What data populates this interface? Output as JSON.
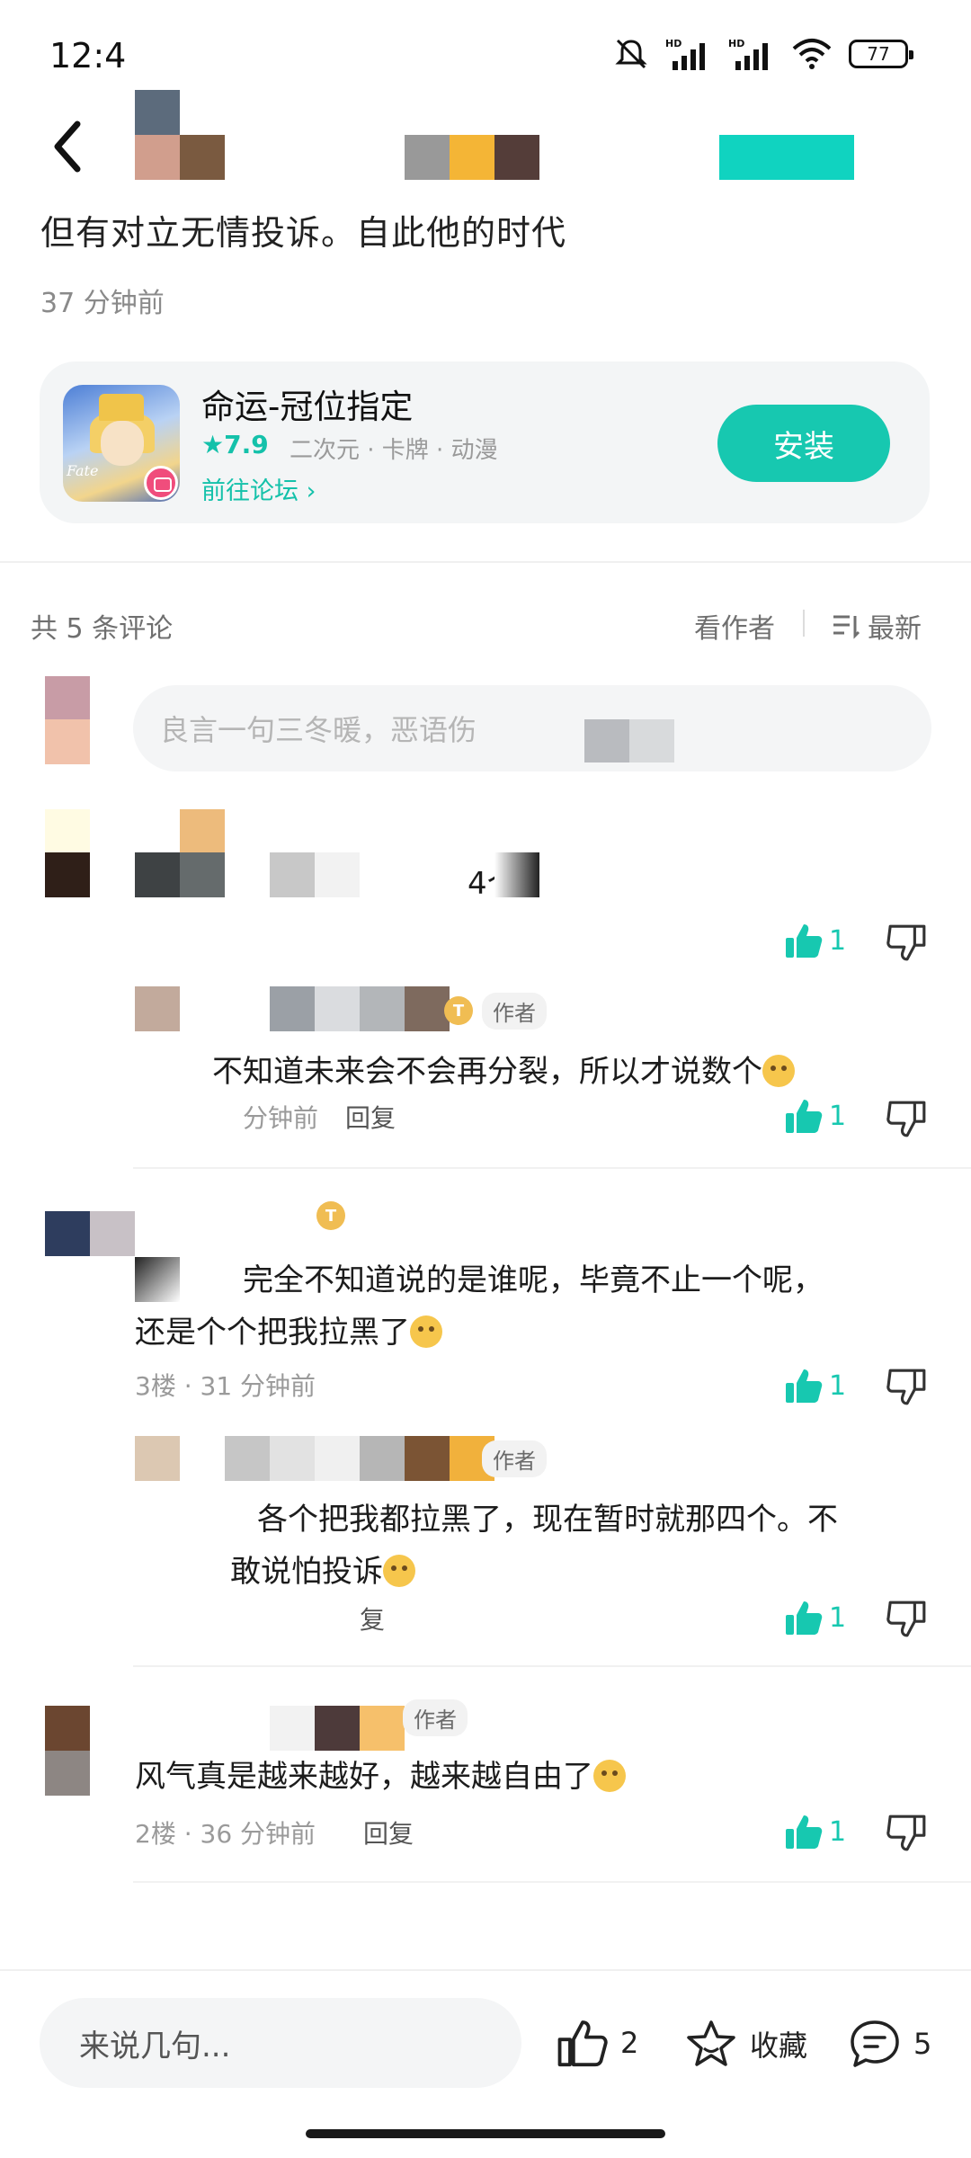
{
  "status_bar": {
    "time": "12:4",
    "battery": "77"
  },
  "post": {
    "excerpt": "但有对立无情投诉。自此他的时代",
    "time": "37 分钟前"
  },
  "game_card": {
    "name": "命运-冠位指定",
    "rating": "★7.9",
    "tags": "二次元 · 卡牌 · 动漫",
    "forum_link": "前往论坛 ›",
    "install_label": "安装",
    "icon_text": "Fate"
  },
  "comments_header": {
    "count": "共 5 条评论",
    "only_author": "看作者",
    "sort_label": "最新"
  },
  "reply_input": {
    "placeholder": "良言一句三冬暖，恶语伤"
  },
  "comments": [
    {
      "text": "4个",
      "likes": "1"
    },
    {
      "author_tag": "作者",
      "text": "不知道未来会不会再分裂，所以才说数个",
      "meta_time": "分钟前",
      "reply_label": "回复",
      "likes": "1"
    },
    {
      "text_line1": "完全不知道说的是谁呢，毕竟不止一个呢，",
      "text_line2": "还是个个把我拉黑了",
      "meta": "3楼 · 31 分钟前",
      "likes": "1"
    },
    {
      "author_tag": "作者",
      "text_line1": "各个把我都拉黑了，现在暂时就那四个。不",
      "text_line2": "敢说怕投诉",
      "reply_label": "复",
      "likes": "1"
    },
    {
      "author_tag": "作者",
      "text": "风气真是越来越好，越来越自由了",
      "meta": "2楼 · 36 分钟前",
      "reply_label": "回复",
      "likes": "1"
    }
  ],
  "bottom_bar": {
    "input_placeholder": "来说几句...",
    "like_count": "2",
    "favorite_label": "收藏",
    "comment_count": "5"
  },
  "colors": {
    "accent": "#17c8b0"
  }
}
